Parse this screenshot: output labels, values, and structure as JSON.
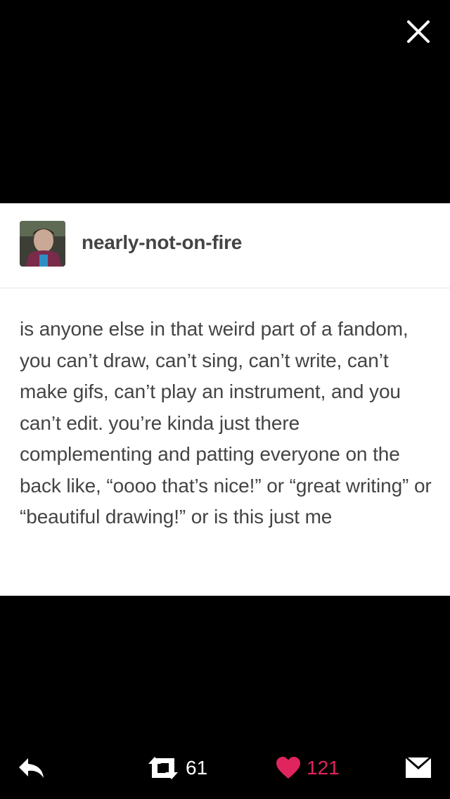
{
  "post": {
    "username": "nearly-not-on-fire",
    "text": "is anyone else in that weird part of a fandom, you can’t draw, can’t sing, can’t write, can’t make gifs, can’t play an instrument, and you can’t edit. you’re kinda just there complementing and patting everyone on the back like, “oooo that’s nice!” or “great writing” or “beautiful drawing!” or is this just me"
  },
  "actions": {
    "reblog_count": "61",
    "like_count": "121"
  },
  "icons": {
    "close": "close-icon",
    "reply": "reply-icon",
    "reblog": "reblog-icon",
    "like": "heart-icon",
    "share": "mail-icon"
  },
  "colors": {
    "background": "#000000",
    "card": "#ffffff",
    "text": "#444444",
    "like": "#e0245e"
  }
}
